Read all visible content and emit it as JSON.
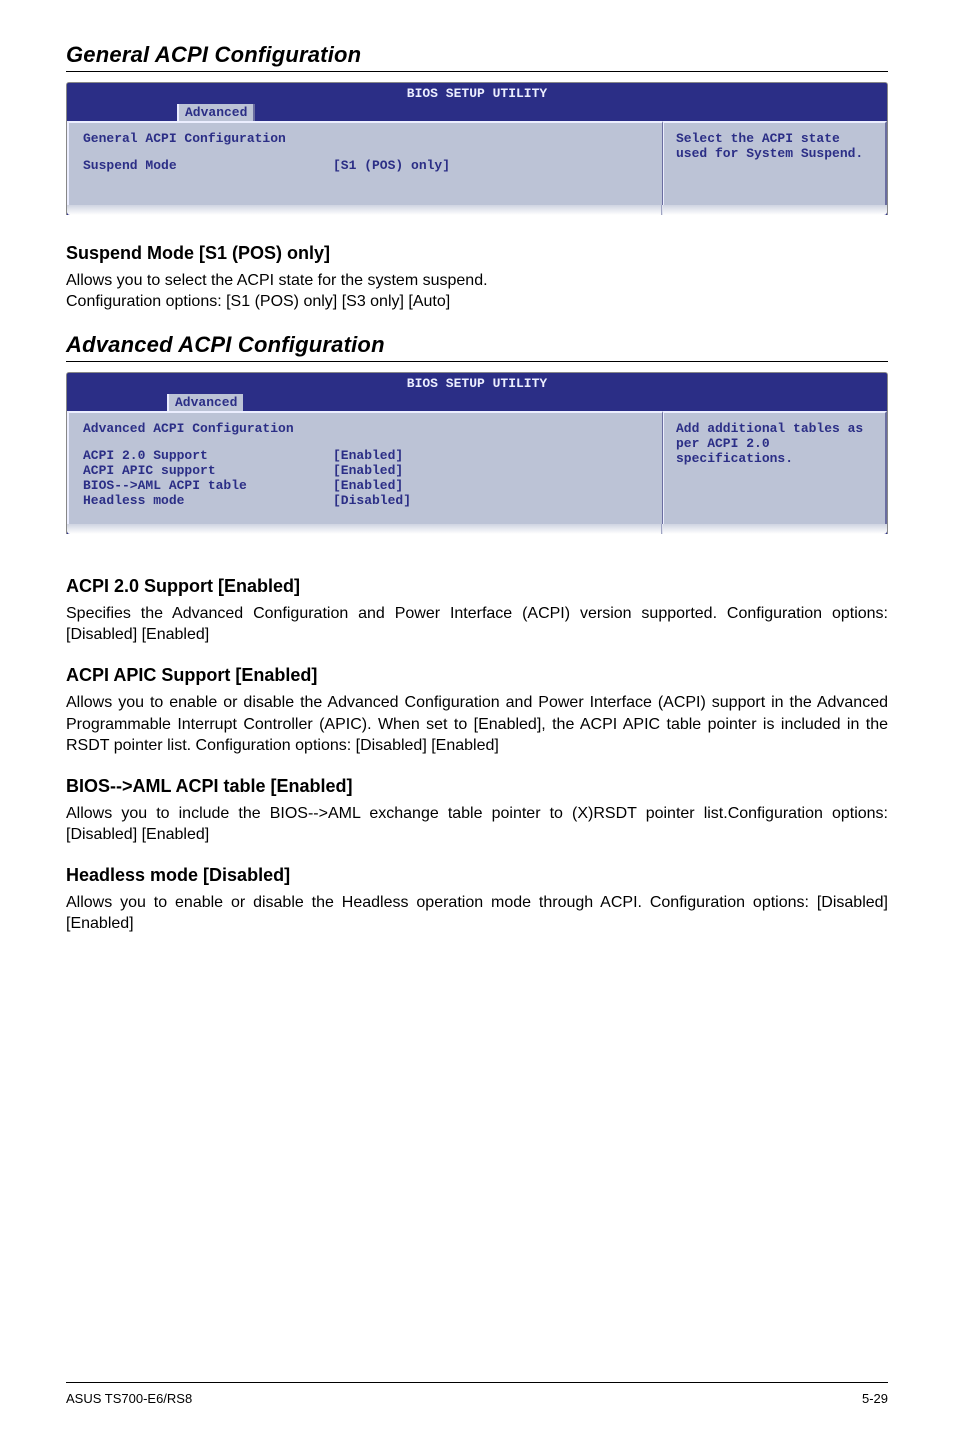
{
  "sections": {
    "general": {
      "heading": "General ACPI Configuration",
      "bios_title": "BIOS SETUP UTILITY",
      "tab": "Advanced",
      "left_header": "General ACPI Configuration",
      "rows": [
        {
          "label": "Suspend Mode",
          "value": "[S1 (POS) only]"
        }
      ],
      "help": "Select the ACPI state used for System Suspend."
    },
    "suspend_mode": {
      "title": "Suspend Mode [S1 (POS) only]",
      "line1": "Allows you to select the ACPI state for the system suspend.",
      "line2": "Configuration options: [S1 (POS) only] [S3 only] [Auto]"
    },
    "advanced": {
      "heading": "Advanced ACPI Configuration",
      "bios_title": "BIOS SETUP UTILITY",
      "tab": "Advanced",
      "left_header": "Advanced ACPI Configuration",
      "rows": [
        {
          "label": "ACPI 2.0 Support",
          "value": "[Enabled]"
        },
        {
          "label": "ACPI APIC support",
          "value": "[Enabled]"
        },
        {
          "label": "BIOS-->AML ACPI table",
          "value": "[Enabled]"
        },
        {
          "label": "Headless mode",
          "value": "[Disabled]"
        }
      ],
      "help": "Add additional tables as per ACPI 2.0 specifications."
    },
    "acpi20": {
      "title": "ACPI 2.0 Support [Enabled]",
      "p": "Specifies the Advanced Configuration and Power Interface (ACPI) version supported. Configuration options: [Disabled] [Enabled]"
    },
    "apic": {
      "title": "ACPI APIC Support [Enabled]",
      "p": "Allows you to enable or disable the Advanced Configuration and Power Interface (ACPI) support in the Advanced Programmable Interrupt Controller (APIC). When set to [Enabled], the ACPI APIC table pointer is included in the RSDT pointer list. Configuration options: [Disabled] [Enabled]"
    },
    "aml": {
      "title": "BIOS-->AML ACPI table [Enabled]",
      "p": "Allows you to include the BIOS-->AML exchange table pointer to (X)RSDT pointer list.Configuration options: [Disabled] [Enabled]"
    },
    "headless": {
      "title": "Headless mode [Disabled]",
      "p": "Allows you to enable or disable the Headless operation mode through ACPI. Configuration options: [Disabled] [Enabled]"
    }
  },
  "footer": {
    "left": "ASUS TS700-E6/RS8",
    "right": "5-29"
  }
}
